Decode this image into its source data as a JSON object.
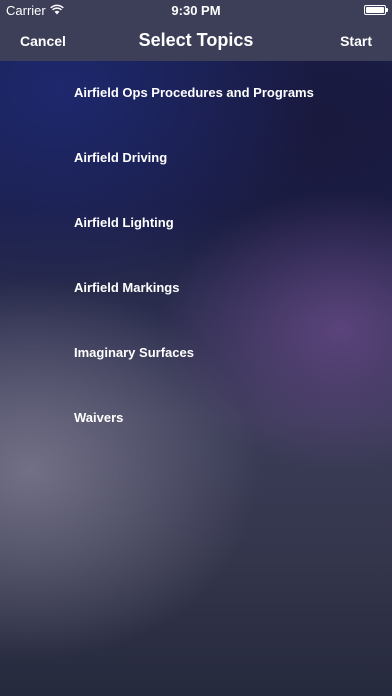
{
  "status_bar": {
    "carrier": "Carrier",
    "time": "9:30 PM",
    "wifi_icon": "wifi-icon",
    "battery_icon": "battery-icon"
  },
  "nav": {
    "left_button": "Cancel",
    "title": "Select Topics",
    "right_button": "Start"
  },
  "topics": [
    {
      "label": "Airfield Ops Procedures and Programs"
    },
    {
      "label": "Airfield Driving"
    },
    {
      "label": "Airfield Lighting"
    },
    {
      "label": "Airfield Markings"
    },
    {
      "label": "Imaginary Surfaces"
    },
    {
      "label": "Waivers"
    }
  ]
}
